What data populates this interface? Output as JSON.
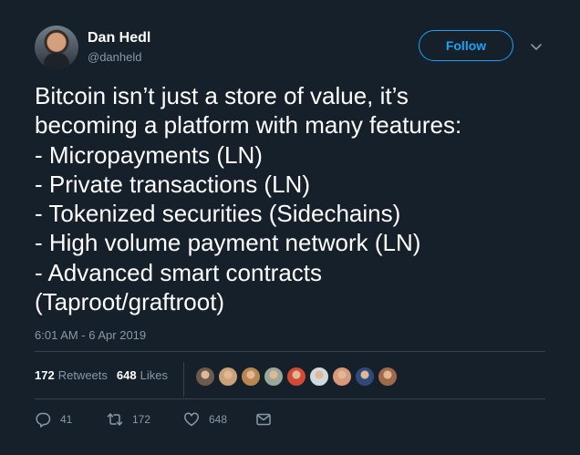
{
  "author": {
    "display_name": "Dan Hedl",
    "handle": "@danheld"
  },
  "follow_label": "Follow",
  "tweet": {
    "lines": [
      "Bitcoin isn’t just a store of value, it’s",
      "becoming a platform with many features:",
      "- Micropayments (LN)",
      "- Private transactions (LN)",
      "- Tokenized securities (Sidechains)",
      "- High volume payment network (LN)",
      "- Advanced smart contracts",
      "(Taproot/graftroot)"
    ],
    "timestamp": "6:01 AM - 6 Apr 2019"
  },
  "stats": {
    "retweets_count": "172",
    "retweets_label": "Retweets",
    "likes_count": "648",
    "likes_label": "Likes"
  },
  "likers": [
    {
      "color": "#6b5a4e"
    },
    {
      "color": "#c9a27a"
    },
    {
      "color": "#b8864f"
    },
    {
      "color": "#9aa89a"
    },
    {
      "color": "#d04a36"
    },
    {
      "color": "#cfd9de"
    },
    {
      "color": "#d69a7a"
    },
    {
      "color": "#2f4a7a"
    },
    {
      "color": "#a06a4a"
    }
  ],
  "actions": {
    "reply_count": "41",
    "retweet_count": "172",
    "like_count": "648"
  },
  "icons": {
    "reply": "reply-icon",
    "retweet": "retweet-icon",
    "like": "heart-icon",
    "message": "envelope-icon",
    "more": "chevron-down-icon"
  },
  "colors": {
    "background": "#15202b",
    "accent": "#1da1f2",
    "secondary_text": "#8899a6",
    "divider": "#38444d"
  }
}
